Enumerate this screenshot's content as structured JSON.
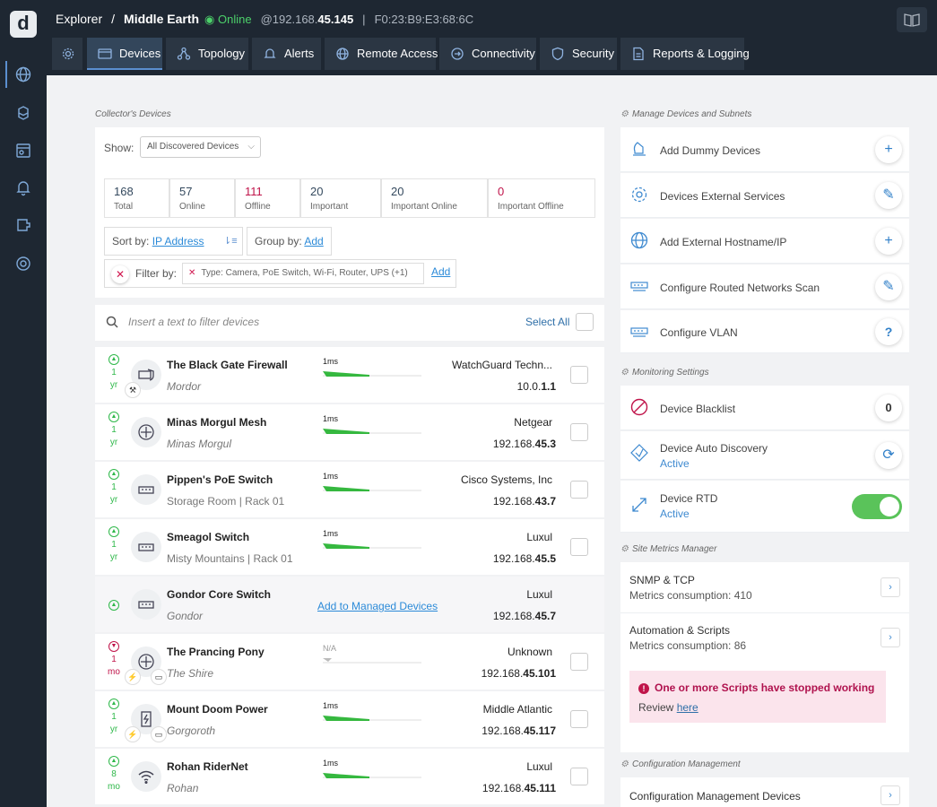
{
  "topbar": {
    "app": "Explorer",
    "separator": "/",
    "site": "Middle Earth",
    "status": "Online",
    "ip_prefix": "@192.168.",
    "ip_suffix": "45.145",
    "divider": "|",
    "mac": "F0:23:B9:E3:68:6C",
    "book_icon": "book-icon"
  },
  "sidebar": {
    "logo": "d",
    "icons": [
      "globe-icon",
      "cubes-icon",
      "dashboard-icon",
      "bell-icon",
      "puzzle-icon",
      "support-icon"
    ]
  },
  "tabs": [
    {
      "label": "",
      "icon": "gear-icon"
    },
    {
      "label": "Devices",
      "icon": "devices-icon"
    },
    {
      "label": "Topology",
      "icon": "topology-icon"
    },
    {
      "label": "Alerts",
      "icon": "bell-icon"
    },
    {
      "label": "Remote Access",
      "icon": "globe-icon"
    },
    {
      "label": "Connectivity",
      "icon": "connectivity-icon"
    },
    {
      "label": "Security",
      "icon": "shield-icon"
    },
    {
      "label": "Reports & Logging",
      "icon": "report-icon"
    }
  ],
  "devices_panel": {
    "section": "Collector's Devices",
    "show_label": "Show:",
    "show_value": "All Discovered Devices",
    "stats": [
      {
        "value": "168",
        "label": "Total"
      },
      {
        "value": "57",
        "label": "Online"
      },
      {
        "value": "111",
        "label": "Offline"
      },
      {
        "value": "20",
        "label": "Important"
      },
      {
        "value": "20",
        "label": "Important Online"
      },
      {
        "value": "0",
        "label": "Important Offline"
      }
    ],
    "sort_label": "Sort by:",
    "sort_value": "IP Address",
    "group_label": "Group by:",
    "group_value": "Add",
    "filter_label": "Filter by:",
    "filter_value": "Type: Camera, PoE Switch, Wi-Fi, Router, UPS (+1)",
    "filter_add": "Add",
    "search_placeholder": "Insert a text to filter devices",
    "select_all": "Select All"
  },
  "devices": [
    {
      "uptime_value": "1",
      "uptime_unit": "yr",
      "name": "The Black Gate Firewall",
      "location": "Mordor",
      "rtd": "1ms",
      "vendor": "WatchGuard Techn...",
      "ip_prefix": "10.0.",
      "ip_suffix": "1.1"
    },
    {
      "uptime_value": "1",
      "uptime_unit": "yr",
      "name": "Minas Morgul Mesh",
      "location": "Minas Morgul",
      "rtd": "1ms",
      "vendor": "Netgear",
      "ip_prefix": "192.168.",
      "ip_suffix": "45.3"
    },
    {
      "uptime_value": "1",
      "uptime_unit": "yr",
      "name": "Pippen's PoE Switch",
      "location": "Storage Room | Rack 01",
      "rtd": "1ms",
      "vendor": "Cisco Systems, Inc",
      "ip_prefix": "192.168.",
      "ip_suffix": "43.7"
    },
    {
      "uptime_value": "1",
      "uptime_unit": "yr",
      "name": "Smeagol Switch",
      "location": "Misty Mountains | Rack 01",
      "rtd": "1ms",
      "vendor": "Luxul",
      "ip_prefix": "192.168.",
      "ip_suffix": "45.5"
    },
    {
      "uptime_value": "",
      "uptime_unit": "",
      "name": "Gondor Core Switch",
      "location": "Gondor",
      "add_link": "Add to Managed Devices",
      "vendor": "Luxul",
      "ip_prefix": "192.168.",
      "ip_suffix": "45.7"
    },
    {
      "uptime_value": "1",
      "uptime_unit": "mo",
      "name": "The Prancing Pony",
      "location": "The Shire",
      "rtd": "N/A",
      "vendor": "Unknown",
      "ip_prefix": "192.168.",
      "ip_suffix": "45.101"
    },
    {
      "uptime_value": "1",
      "uptime_unit": "yr",
      "name": "Mount Doom Power",
      "location": "Gorgoroth",
      "rtd": "1ms",
      "vendor": "Middle Atlantic",
      "ip_prefix": "192.168.",
      "ip_suffix": "45.117"
    },
    {
      "uptime_value": "8",
      "uptime_unit": "mo",
      "name": "Rohan RiderNet",
      "location": "Rohan",
      "rtd": "1ms",
      "vendor": "Luxul",
      "ip_prefix": "192.168.",
      "ip_suffix": "45.111"
    }
  ],
  "manage": {
    "section": "Manage Devices and Subnets",
    "items": [
      {
        "label": "Add Dummy Devices",
        "icon": "dummy-device-icon",
        "action": "+"
      },
      {
        "label": "Devices External Services",
        "icon": "gear-icon",
        "action": "✎"
      },
      {
        "label": "Add External Hostname/IP",
        "icon": "globe-icon",
        "action": "+"
      },
      {
        "label": "Configure Routed Networks Scan",
        "icon": "network-icon",
        "action": "✎"
      },
      {
        "label": "Configure VLAN",
        "icon": "network-icon",
        "action": "?"
      }
    ]
  },
  "monitoring": {
    "section": "Monitoring Settings",
    "blacklist_label": "Device Blacklist",
    "blacklist_count": "0",
    "auto_discovery_label": "Device Auto Discovery",
    "auto_discovery_status": "Active",
    "rtd_label": "Device RTD",
    "rtd_status": "Active",
    "rtd_enabled": true
  },
  "metrics": {
    "section": "Site Metrics Manager",
    "items": [
      {
        "title": "SNMP & TCP",
        "subtitle": "Metrics consumption: 410"
      },
      {
        "title": "Automation & Scripts",
        "subtitle": "Metrics consumption: 86"
      }
    ],
    "alert_title": "One or more Scripts have stopped working",
    "alert_review": "Review",
    "alert_link": "here"
  },
  "config": {
    "section": "Configuration Management",
    "item": "Configuration Management Devices"
  },
  "colors": {
    "bg_dark": "#1e2732",
    "accent": "#3f8ad0",
    "online": "#2fb84a",
    "offline": "#c0144a"
  }
}
